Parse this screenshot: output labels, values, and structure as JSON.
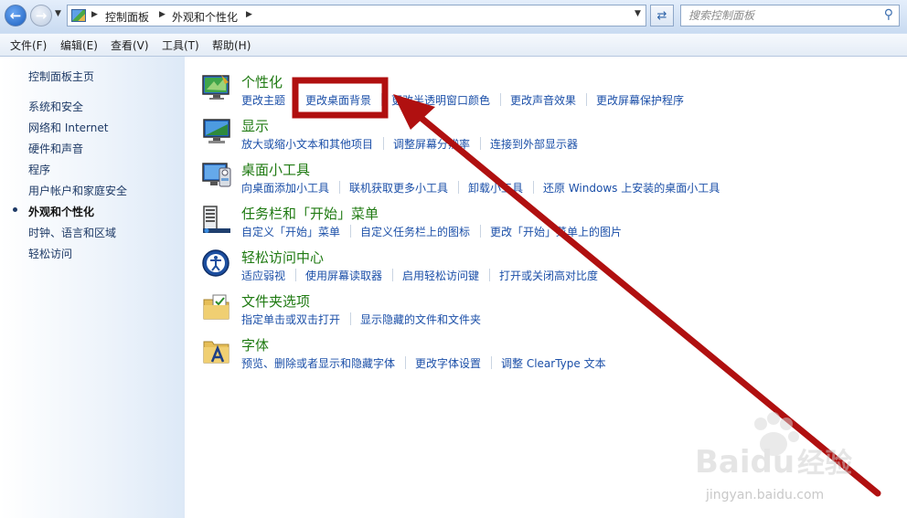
{
  "address_bar": {
    "breadcrumbs": [
      "控制面板",
      "外观和个性化"
    ],
    "search_placeholder": "搜索控制面板"
  },
  "menu": [
    "文件(F)",
    "编辑(E)",
    "查看(V)",
    "工具(T)",
    "帮助(H)"
  ],
  "sidebar": {
    "home": "控制面板主页",
    "items": [
      "系统和安全",
      "网络和 Internet",
      "硬件和声音",
      "程序",
      "用户帐户和家庭安全",
      "外观和个性化",
      "时钟、语言和区域",
      "轻松访问"
    ],
    "active_index": 5
  },
  "categories": [
    {
      "title": "个性化",
      "icon": "personalization-icon",
      "links": [
        "更改主题",
        "更改桌面背景",
        "更改半透明窗口颜色",
        "更改声音效果",
        "更改屏幕保护程序"
      ]
    },
    {
      "title": "显示",
      "icon": "display-icon",
      "links": [
        "放大或缩小文本和其他项目",
        "调整屏幕分辨率",
        "连接到外部显示器"
      ]
    },
    {
      "title": "桌面小工具",
      "icon": "gadgets-icon",
      "links": [
        "向桌面添加小工具",
        "联机获取更多小工具",
        "卸载小工具",
        "还原 Windows 上安装的桌面小工具"
      ]
    },
    {
      "title": "任务栏和「开始」菜单",
      "icon": "taskbar-icon",
      "links": [
        "自定义「开始」菜单",
        "自定义任务栏上的图标",
        "更改「开始」菜单上的图片"
      ]
    },
    {
      "title": "轻松访问中心",
      "icon": "ease-of-access-icon",
      "links": [
        "适应弱视",
        "使用屏幕读取器",
        "启用轻松访问键",
        "打开或关闭高对比度"
      ]
    },
    {
      "title": "文件夹选项",
      "icon": "folder-options-icon",
      "links": [
        "指定单击或双击打开",
        "显示隐藏的文件和文件夹"
      ]
    },
    {
      "title": "字体",
      "icon": "fonts-icon",
      "links": [
        "预览、删除或者显示和隐藏字体",
        "更改字体设置",
        "调整 ClearType 文本"
      ]
    }
  ],
  "annotation": {
    "highlight_color": "#b01010",
    "highlighted_link": "更改桌面背景"
  },
  "watermark": {
    "logo_text": "Baidu经验",
    "url": "jingyan.baidu.com"
  }
}
